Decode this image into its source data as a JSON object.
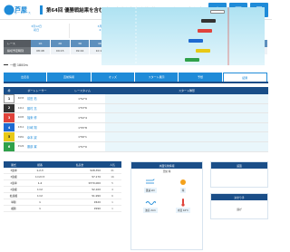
{
  "header": {
    "logo": "芦屋",
    "logo_sub": "ボートレース",
    "title": "第64回 優勝戦結果を含む 今垣光太郎杯争奪戦 芦屋オープン4周年記念",
    "icons": [
      {
        "name": "home-icon",
        "label": "ホーム"
      },
      {
        "name": "schedule-icon",
        "label": "日程"
      },
      {
        "name": "menu-icon",
        "label": "メニュー"
      }
    ]
  },
  "day_tabs": [
    {
      "date": "3月12日",
      "day": "初日"
    },
    {
      "date": "3月13日",
      "day": "2日目"
    },
    {
      "date": "3月14日",
      "day": "3日目"
    },
    {
      "date": "3月15日",
      "day": "最終日"
    }
  ],
  "race_strip": {
    "head_race": "レース",
    "head_time": "締切予定時刻",
    "races": [
      "1R",
      "2R",
      "3R",
      "4R",
      "5R",
      "6R",
      "7R",
      "8R",
      "9R",
      "10R",
      "11R",
      "12R"
    ],
    "times": [
      "08:48",
      "09:15",
      "09:44",
      "10:13",
      "10:42",
      "11:11",
      "11:40",
      "12:09",
      "12:38",
      "13:07",
      "13:36",
      "14:05"
    ]
  },
  "race_info": {
    "title": "一般 1800m"
  },
  "sub_tabs": [
    "出走表",
    "直前情報",
    "オッズ",
    "スタート展示",
    "予想",
    "結果"
  ],
  "entry_head": {
    "waku": "枠",
    "racer": "ボートレーサー",
    "st": "レースタイム",
    "pred": "スタート隊形"
  },
  "entries": [
    {
      "waku": "1",
      "num": "4633",
      "name": "前田 拓",
      "st": "1'52\"9"
    },
    {
      "waku": "2",
      "num": "4412",
      "name": "藤村 亮",
      "st": "1'53\"6"
    },
    {
      "waku": "3",
      "num": "4095",
      "name": "福東 修",
      "st": "1'54\"4"
    },
    {
      "waku": "4",
      "num": "4312",
      "name": "杉崎 翔",
      "st": "1'55\"8"
    },
    {
      "waku": "5",
      "num": "3981",
      "name": "幸本 誠",
      "st": "1'56\"1"
    },
    {
      "waku": "6",
      "num": "4526",
      "name": "服部 翼",
      "st": "1'57\"0"
    }
  ],
  "result_head": {
    "kind": "勝式",
    "combo": "組番",
    "pay": "払戻金",
    "pop": "人気"
  },
  "results": [
    {
      "kind": "3連単",
      "combo": "1-2-3",
      "pay": "¥28,350",
      "pop": "41"
    },
    {
      "kind": "3連複",
      "combo": "1=2=3",
      "pay": "¥7,170",
      "pop": "16"
    },
    {
      "kind": "2連単",
      "combo": "1-2",
      "pay": "¥370,000",
      "pop": "5"
    },
    {
      "kind": "2連複",
      "combo": "1=2",
      "pay": "¥2,100",
      "pop": "4"
    },
    {
      "kind": "拡連複",
      "combo": "1=2",
      "pay": "¥1,990",
      "pop": "6"
    },
    {
      "kind": "単勝",
      "combo": "1",
      "pay": "¥420",
      "pop": "1"
    },
    {
      "kind": "複勝",
      "combo": "1",
      "pay": "¥290",
      "pop": "1"
    }
  ],
  "weather": {
    "head": "水面気象情報",
    "sub": "天候 晴",
    "cells": [
      {
        "icon": "wind-icon",
        "label": "風速 2m"
      },
      {
        "icon": "sun-icon",
        "label": "晴"
      },
      {
        "icon": "wave-icon",
        "label": "波高 2cm"
      },
      {
        "icon": "temp-icon",
        "label": "水温 16℃"
      }
    ]
  },
  "side_boxes": [
    {
      "head": "返還",
      "body": ""
    },
    {
      "head": "決まり手",
      "body": "逃げ"
    }
  ],
  "colors": {
    "brand": "#1f8bd8",
    "dark": "#1a4e88",
    "waku": [
      "#ffffff",
      "#333333",
      "#e0433b",
      "#1f6ad1",
      "#e8c917",
      "#2fa14a"
    ]
  }
}
